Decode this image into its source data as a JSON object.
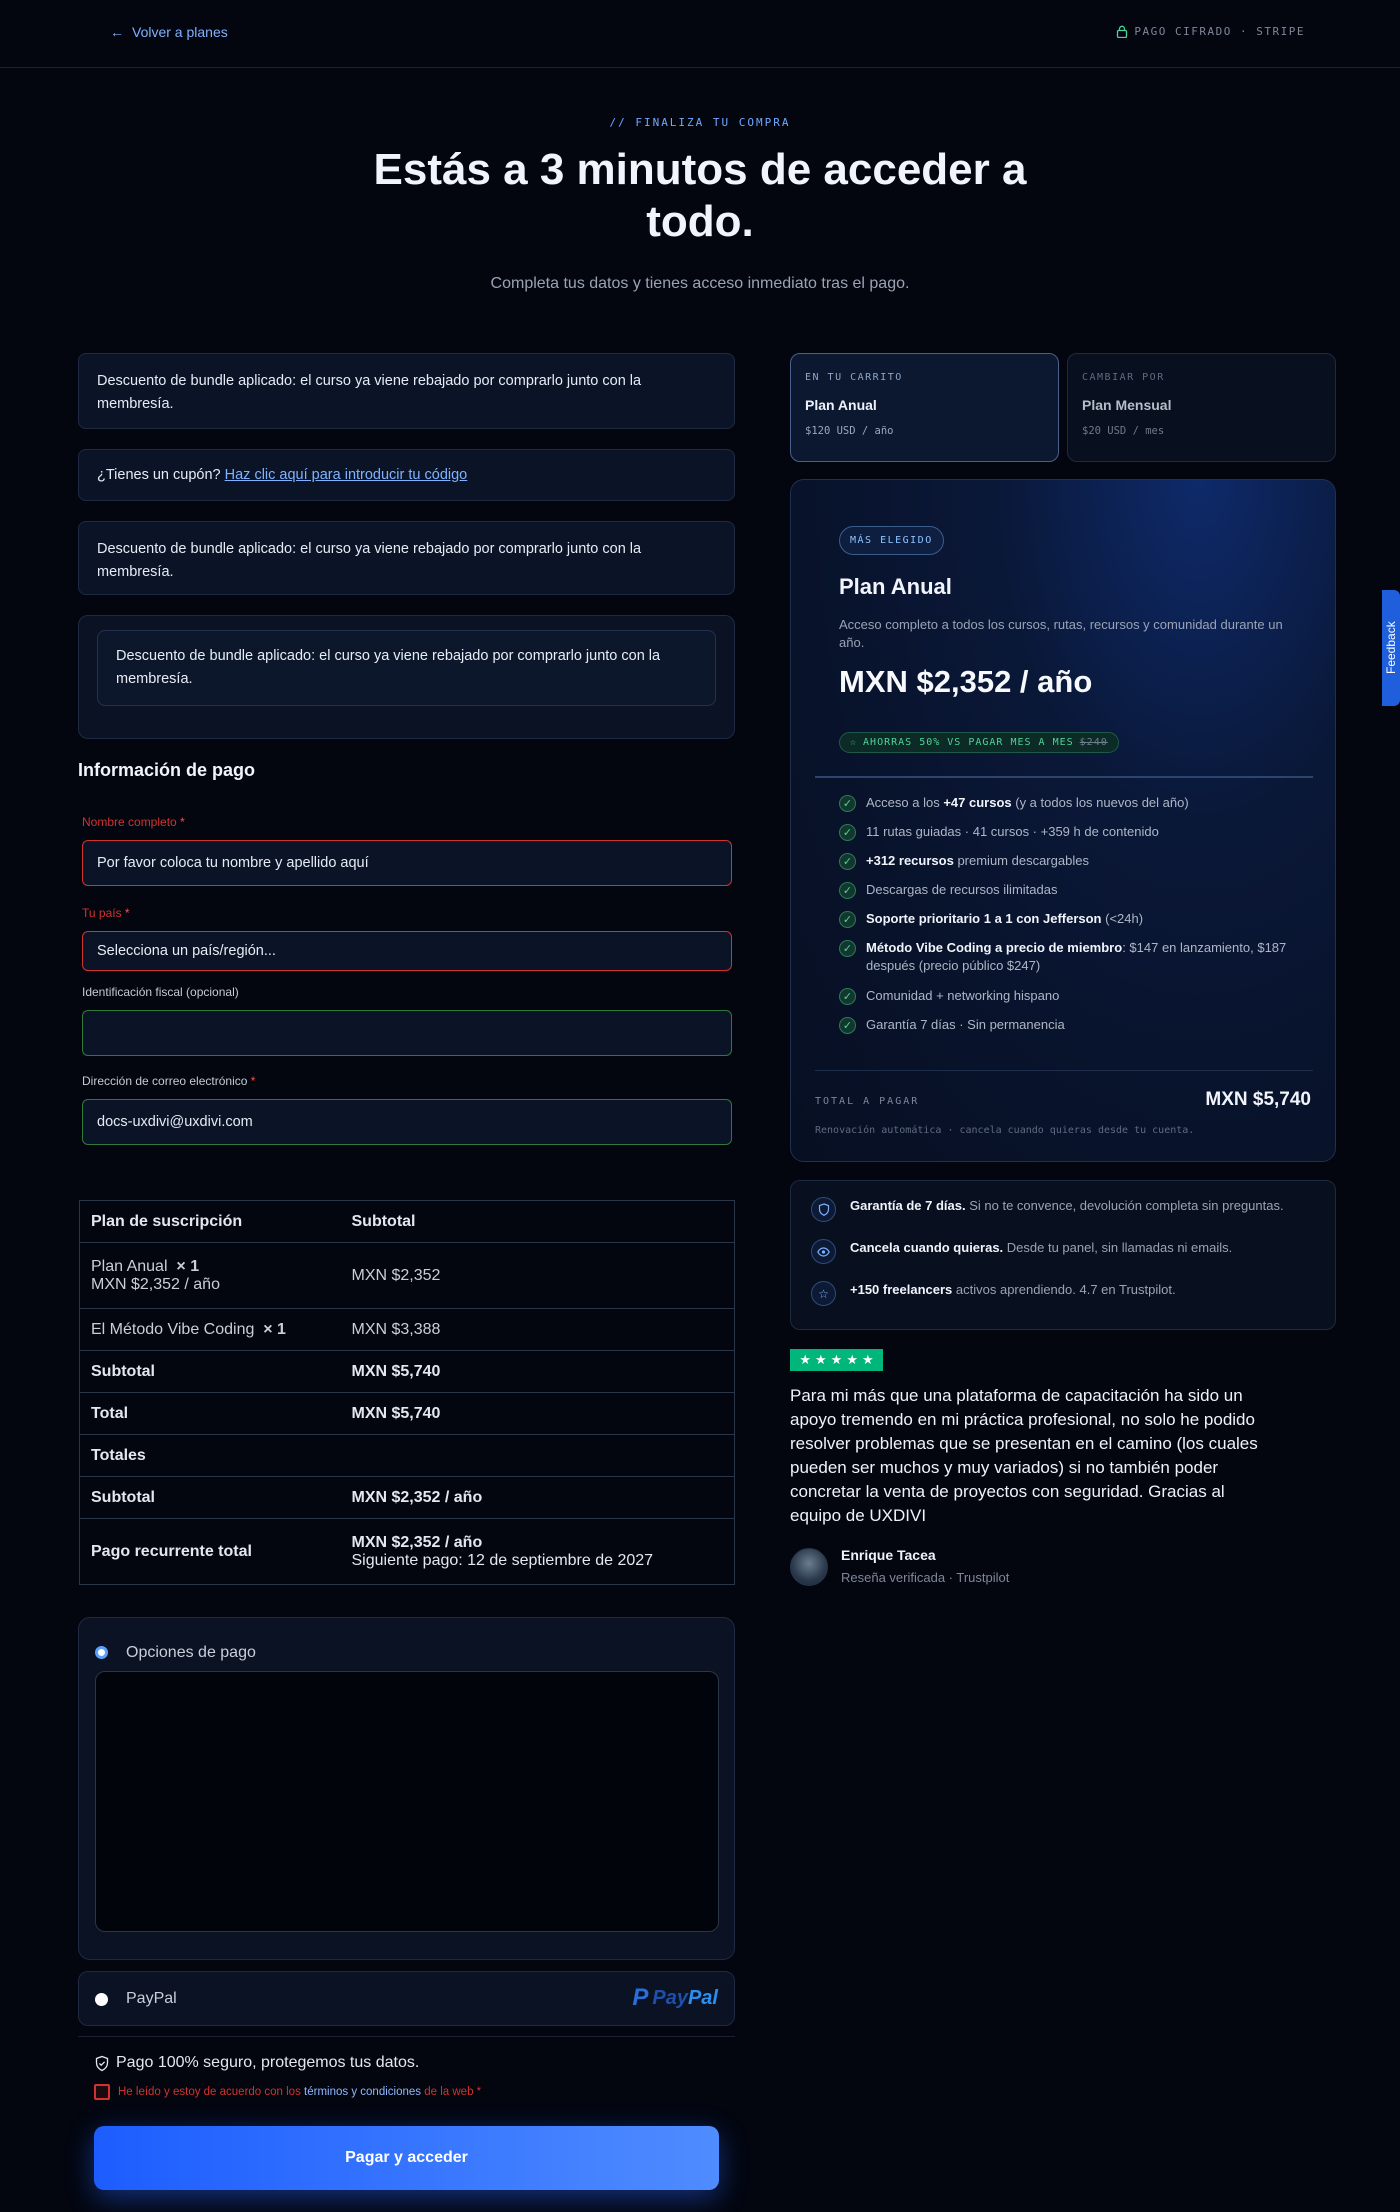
{
  "topbar": {
    "back_label": "Volver a planes",
    "secure_label": "PAGO CIFRADO · STRIPE"
  },
  "hero": {
    "eyebrow": "// FINALIZA TU COMPRA",
    "title": "Estás a 3 minutos de acceder a todo.",
    "subtitle": "Completa tus datos y tienes acceso inmediato tras el pago."
  },
  "notices": {
    "bundle_1": "Descuento de bundle aplicado: el curso ya viene rebajado por comprarlo junto con la membresía.",
    "coupon_prefix": "¿Tienes un cupón?",
    "coupon_link": "Haz clic aquí para introducir tu código",
    "bundle_2": "Descuento de bundle aplicado: el curso ya viene rebajado por comprarlo junto con la membresía.",
    "bundle_3": "Descuento de bundle aplicado: el curso ya viene rebajado por comprarlo junto con la membresía."
  },
  "form": {
    "section_title": "Información de pago",
    "name_label": "Nombre completo",
    "name_value": "Por favor coloca tu nombre y apellido aquí",
    "country_label": "Tu país",
    "country_value": "Selecciona un país/región...",
    "tax_label": "Identificación fiscal (opcional)",
    "tax_value": "",
    "email_label": "Dirección de correo electrónico",
    "email_value": "docs-uxdivi@uxdivi.com",
    "required_mark": "*"
  },
  "order_table": {
    "headers": [
      "Plan de suscripción",
      "Subtotal"
    ],
    "item_1_name": "Plan Anual",
    "item_1_qty": "× 1",
    "item_1_sub": "MXN $2,352 / año",
    "item_1_price": "MXN $2,352",
    "item_2_name": "El Método Vibe Coding",
    "item_2_qty": "× 1",
    "item_2_price": "MXN $3,388",
    "subtotal_label": "Subtotal",
    "subtotal_value": "MXN $5,740",
    "total_label": "Total",
    "total_value": "MXN $5,740",
    "totals_label": "Totales",
    "rec_subtotal_label": "Subtotal",
    "rec_subtotal_value": "MXN $2,352 / año",
    "recurring_label": "Pago recurrente total",
    "recurring_value": "MXN $2,352 / año",
    "next_payment": "Siguiente pago: 12 de septiembre de 2027"
  },
  "payment": {
    "options_label": "Opciones de pago",
    "paypal_label": "PayPal",
    "paypal_logo_pay": "Pay",
    "paypal_logo_pal": "Pal",
    "secure_text": "Pago 100% seguro, protegemos tus datos.",
    "terms_prefix": "He leído y estoy de acuerdo con los",
    "terms_link": "términos y condiciones",
    "terms_suffix": "de la web",
    "terms_required": "*",
    "pay_button": "Pagar y acceder"
  },
  "plan_tabs": {
    "current_key": "EN TU CARRITO",
    "current_name": "Plan Anual",
    "current_price": "$120 USD / año",
    "alt_key": "CAMBIAR POR",
    "alt_name": "Plan Mensual",
    "alt_price": "$20 USD / mes"
  },
  "plan_card": {
    "badge": "MÁS ELEGIDO",
    "title": "Plan Anual",
    "description": "Acceso completo a todos los cursos, rutas, recursos y comunidad durante un año.",
    "price": "MXN $2,352 / año",
    "savings": "AHORRAS 50% VS PAGAR MES A MES",
    "savings_old": "$240",
    "features": [
      {
        "pre": "Acceso a los ",
        "bold": "+47 cursos",
        "post": " (y a todos los nuevos del año)"
      },
      {
        "pre": "11 rutas guiadas · 41 cursos · +359 h de contenido",
        "bold": "",
        "post": ""
      },
      {
        "pre": "",
        "bold": "+312 recursos",
        "post": " premium descargables"
      },
      {
        "pre": "Descargas de recursos ilimitadas",
        "bold": "",
        "post": ""
      },
      {
        "pre": "",
        "bold": "Soporte prioritario 1 a 1 con Jefferson",
        "post": " (<24h)"
      },
      {
        "pre": "",
        "bold": "Método Vibe Coding a precio de miembro",
        "post": ": $147 en lanzamiento, $187 después (precio público $247)"
      },
      {
        "pre": "Comunidad + networking hispano",
        "bold": "",
        "post": ""
      },
      {
        "pre": "Garantía 7 días · Sin permanencia",
        "bold": "",
        "post": ""
      }
    ],
    "total_label": "TOTAL A PAGAR",
    "total_value": "MXN $5,740",
    "renewal": "Renovación automática · cancela cuando quieras desde tu cuenta."
  },
  "guarantees": [
    {
      "icon": "shield-icon",
      "bold": "Garantía de 7 días.",
      "text": " Si no te convence, devolución completa sin preguntas."
    },
    {
      "icon": "eye-icon",
      "bold": "Cancela cuando quieras.",
      "text": " Desde tu panel, sin llamadas ni emails."
    },
    {
      "icon": "star-icon",
      "bold": "+150 freelancers",
      "text": " activos aprendiendo. 4.7 en Trustpilot."
    }
  ],
  "review": {
    "rating": 5,
    "quote": "Para mi más que una plataforma de capacitación ha sido un apoyo tremendo en mi práctica profesional, no solo he podido resolver problemas que se presentan en el camino (los cuales pueden ser muchos y muy variados) si no también poder concretar la venta de proyectos con seguridad. Gracias al equipo de UXDIVI",
    "name": "Enrique Tacea",
    "meta": "Reseña verificada · Trustpilot"
  },
  "feedback_tab": "Feedback",
  "colors": {
    "accent": "#1d5dff",
    "error": "#d2322f",
    "success": "#4fd39a",
    "trustpilot": "#00b67a"
  }
}
